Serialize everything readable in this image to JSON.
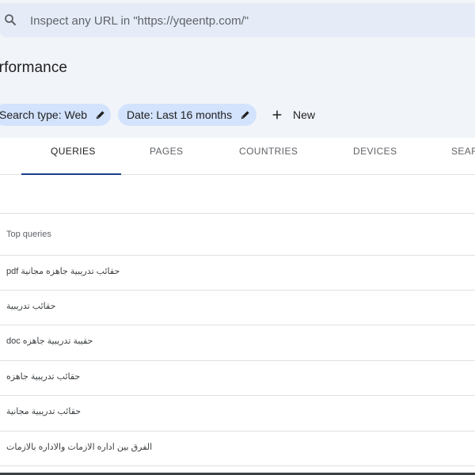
{
  "search": {
    "placeholder": "Inspect any URL in \"https://yqeentp.com/\""
  },
  "page": {
    "title": "erformance"
  },
  "filters": {
    "search_type": "Search type: Web",
    "date": "Date: Last 16 months",
    "new_label": "New"
  },
  "tabs": [
    {
      "label": "QUERIES",
      "active": true
    },
    {
      "label": "PAGES",
      "active": false
    },
    {
      "label": "COUNTRIES",
      "active": false
    },
    {
      "label": "DEVICES",
      "active": false
    },
    {
      "label": "SEAR",
      "active": false
    }
  ],
  "table": {
    "header": "Top queries",
    "rows": [
      "pdf حقائب تدريبية جاهزه مجانية",
      "حقائب تدريبية",
      "doc حقيبة تدريبية جاهزه",
      "حقائب تدريبية جاهزه",
      "حقائب تدريبية مجانية",
      "الفرق بين اداره الازمات والاداره بالازمات"
    ]
  },
  "colors": {
    "background": "#f1f4f8",
    "search_bar": "#e6ecf7",
    "chip": "#d3e3fd",
    "tab_indicator": "#1a3e8c"
  },
  "icons": {
    "search": "search-icon",
    "edit": "pencil-icon",
    "add": "plus-icon"
  }
}
